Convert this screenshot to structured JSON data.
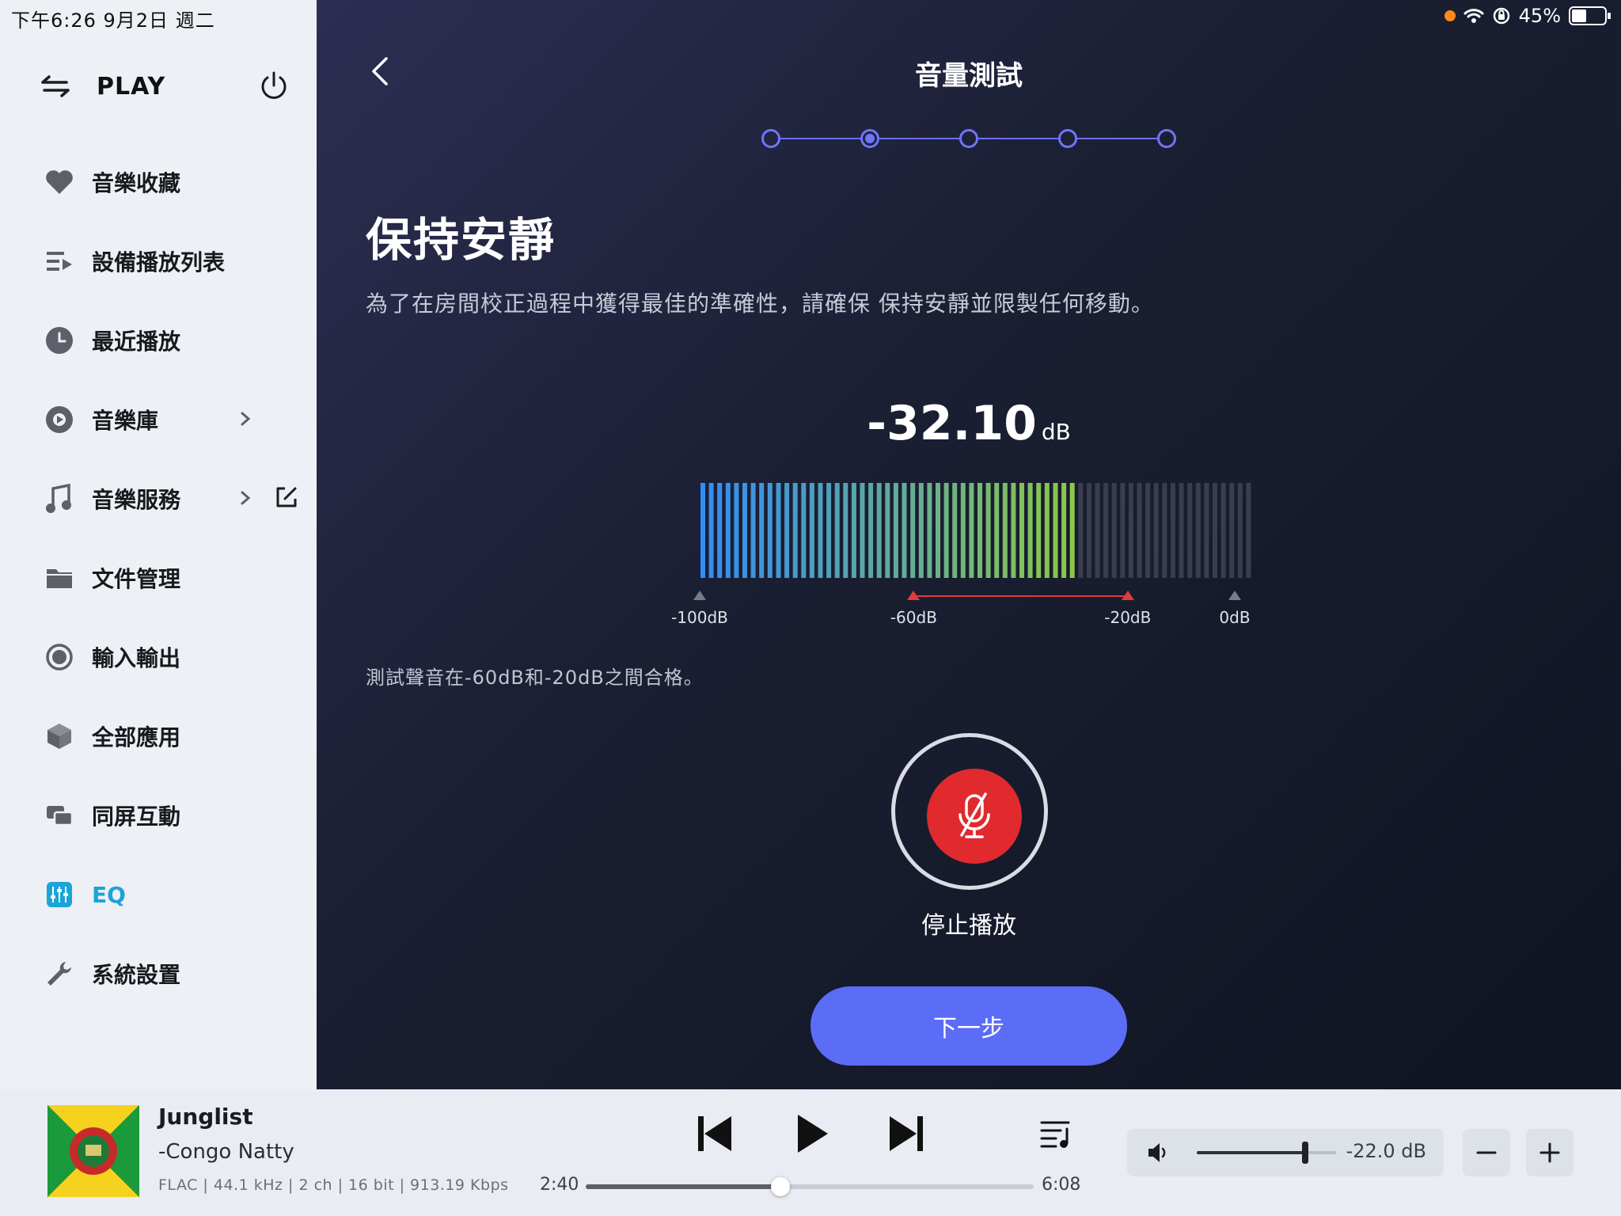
{
  "status": {
    "time_date": "下午6:26   9月2日 週二",
    "battery": "45%",
    "battery_level": 0.45
  },
  "sidebar": {
    "brand": "PLAY",
    "items": [
      {
        "label": "音樂收藏",
        "icon": "heart-icon"
      },
      {
        "label": "設備播放列表",
        "icon": "playlist-icon"
      },
      {
        "label": "最近播放",
        "icon": "clock-icon"
      },
      {
        "label": "音樂庫",
        "icon": "disc-icon"
      },
      {
        "label": "音樂服務",
        "icon": "music-note-icon"
      },
      {
        "label": "文件管理",
        "icon": "folder-icon"
      },
      {
        "label": "輸入輸出",
        "icon": "radio-icon"
      },
      {
        "label": "全部應用",
        "icon": "cube-icon"
      },
      {
        "label": "同屏互動",
        "icon": "screens-icon"
      },
      {
        "label": "EQ",
        "icon": "eq-icon",
        "active": true
      },
      {
        "label": "系統設置",
        "icon": "wrench-icon"
      }
    ]
  },
  "main": {
    "title": "音量測試",
    "steps_total": 5,
    "active_step": 2,
    "heading": "保持安靜",
    "description": "為了在房間校正過程中獲得最佳的準確性，請確保 保持安靜並限製任何移動。",
    "db_value": "-32.10",
    "db_unit": "dB",
    "meter_level_db": -32.1,
    "meter_range_db": [
      -100,
      0
    ],
    "scale": [
      "-100dB",
      "-60dB",
      "-20dB",
      "0dB"
    ],
    "pass_range_db": [
      -60,
      -20
    ],
    "note": "測試聲音在-60dB和-20dB之間合格。",
    "record_label": "停止播放",
    "next_label": "下一步"
  },
  "player": {
    "title": "Junglist",
    "artist": "-Congo Natty",
    "meta": "FLAC | 44.1 kHz | 2 ch | 16 bit | 913.19 Kbps",
    "time_current": "2:40",
    "time_total": "6:08",
    "progress": 0.435,
    "volume_value": "-22.0 dB",
    "volume_level": 0.78
  },
  "colors": {
    "accent": "#5b6cf6",
    "record": "#e02a2e",
    "eq_active": "#1aa4d8"
  }
}
